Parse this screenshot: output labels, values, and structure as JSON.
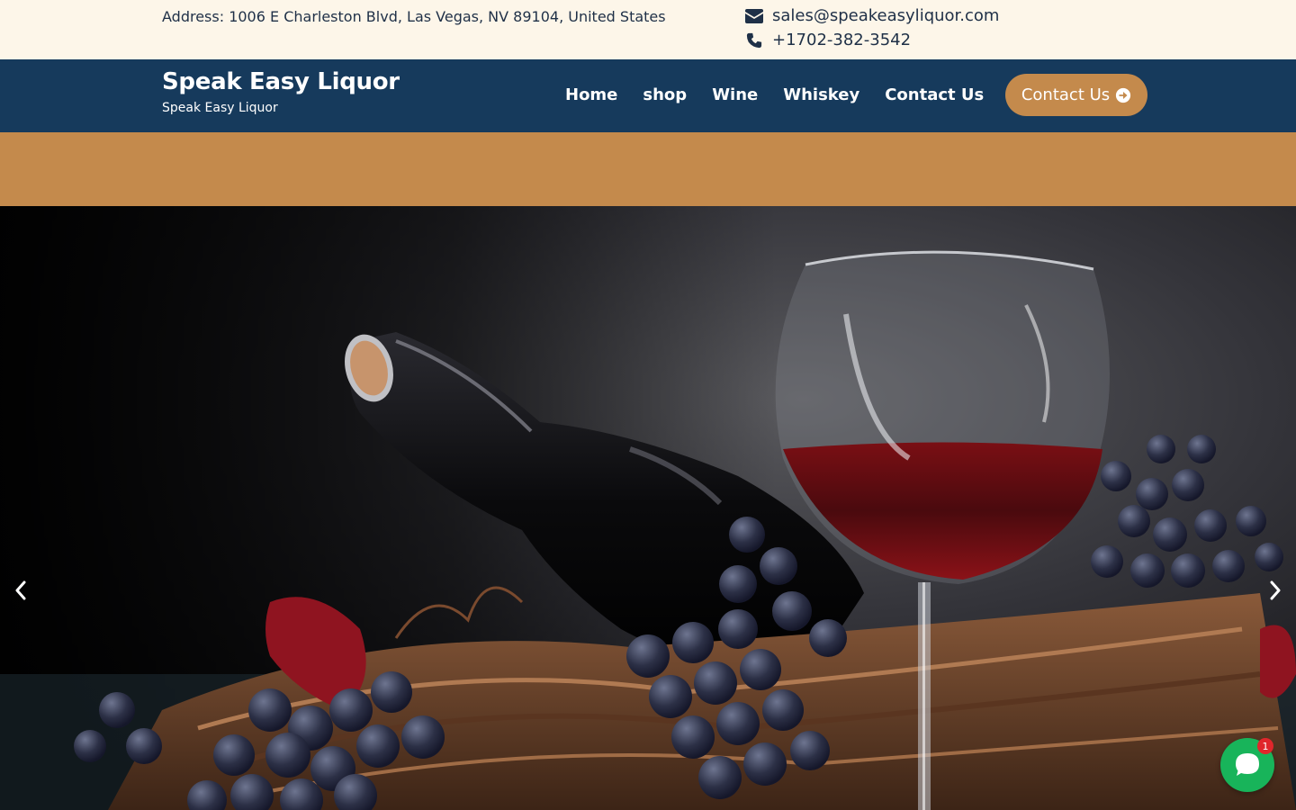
{
  "topbar": {
    "address": "Address: 1006 E Charleston Blvd, Las Vegas, NV 89104, United States",
    "email": "sales@speakeasyliquor.com",
    "phone": "+1702-382-3542"
  },
  "navbar": {
    "brand_title": "Speak Easy Liquor",
    "brand_subtitle": "Speak Easy Liquor",
    "links": [
      {
        "label": "Home"
      },
      {
        "label": "shop"
      },
      {
        "label": "Wine"
      },
      {
        "label": "Whiskey"
      },
      {
        "label": "Contact Us"
      }
    ],
    "cta_label": "Contact Us"
  },
  "chat": {
    "badge_count": "1"
  },
  "colors": {
    "topbar_bg": "#fdf6e9",
    "navbar_bg": "#163a5c",
    "accent": "#c48a4c",
    "chat_green": "#18b45a",
    "badge_red": "#e0262b"
  },
  "icons": {
    "email": "envelope-icon",
    "phone": "phone-icon",
    "cta": "arrow-circle-right-icon",
    "prev": "chevron-left-icon",
    "next": "chevron-right-icon",
    "chat": "chat-bubble-icon"
  }
}
